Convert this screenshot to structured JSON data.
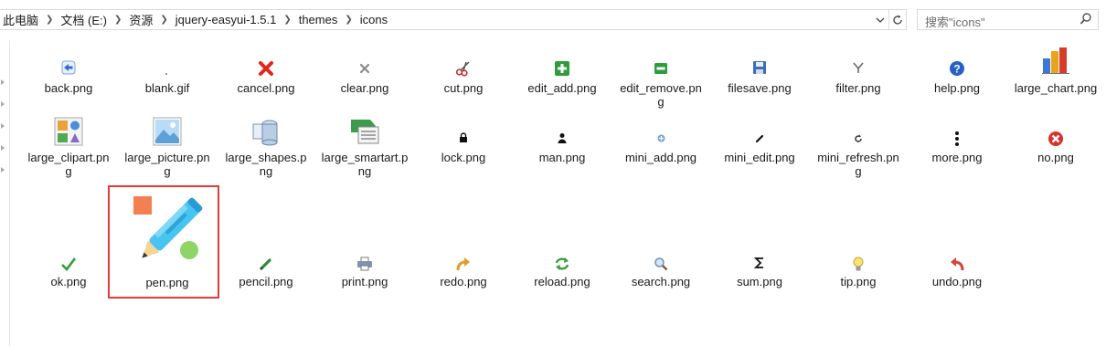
{
  "address": {
    "crumbs": [
      "此电脑",
      "文档 (E:)",
      "资源",
      "jquery-easyui-1.5.1",
      "themes",
      "icons"
    ]
  },
  "search": {
    "placeholder": "搜索\"icons\""
  },
  "files": [
    {
      "name": "back.png",
      "icon": "back-arrow-icon"
    },
    {
      "name": "blank.gif",
      "icon": "blank-dot-icon"
    },
    {
      "name": "cancel.png",
      "icon": "red-x-icon"
    },
    {
      "name": "clear.png",
      "icon": "gray-x-icon"
    },
    {
      "name": "cut.png",
      "icon": "scissors-icon"
    },
    {
      "name": "edit_add.png",
      "icon": "green-plus-icon"
    },
    {
      "name": "edit_remove.png",
      "icon": "green-minus-icon"
    },
    {
      "name": "filesave.png",
      "icon": "floppy-icon"
    },
    {
      "name": "filter.png",
      "icon": "filter-icon"
    },
    {
      "name": "help.png",
      "icon": "help-icon"
    },
    {
      "name": "large_chart.png",
      "icon": "bar-chart-icon"
    },
    {
      "name": "large_clipart.png",
      "icon": "clipart-icon"
    },
    {
      "name": "large_picture.png",
      "icon": "picture-icon"
    },
    {
      "name": "large_shapes.png",
      "icon": "shapes-icon"
    },
    {
      "name": "large_smartart.png",
      "icon": "smartart-icon"
    },
    {
      "name": "lock.png",
      "icon": "lock-icon"
    },
    {
      "name": "man.png",
      "icon": "man-icon"
    },
    {
      "name": "mini_add.png",
      "icon": "mini-add-icon"
    },
    {
      "name": "mini_edit.png",
      "icon": "mini-edit-icon"
    },
    {
      "name": "mini_refresh.png",
      "icon": "mini-refresh-icon"
    },
    {
      "name": "more.png",
      "icon": "more-icon"
    },
    {
      "name": "no.png",
      "icon": "no-icon"
    },
    {
      "name": "ok.png",
      "icon": "ok-icon"
    },
    {
      "name": "pen.png",
      "icon": "pen-icon",
      "selected": true
    },
    {
      "name": "pencil.png",
      "icon": "pencil-icon"
    },
    {
      "name": "print.png",
      "icon": "printer-icon"
    },
    {
      "name": "redo.png",
      "icon": "redo-icon"
    },
    {
      "name": "reload.png",
      "icon": "reload-icon"
    },
    {
      "name": "search.png",
      "icon": "search-icon"
    },
    {
      "name": "sum.png",
      "icon": "sum-icon"
    },
    {
      "name": "tip.png",
      "icon": "lightbulb-icon"
    },
    {
      "name": "undo.png",
      "icon": "undo-icon"
    }
  ],
  "colors": {
    "selection_border": "#e03a3a"
  }
}
